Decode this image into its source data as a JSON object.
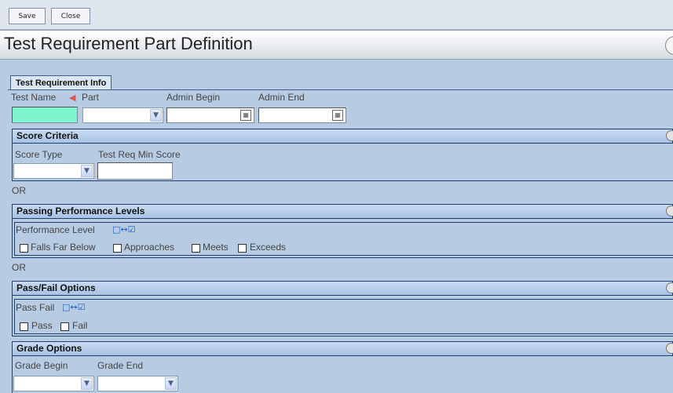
{
  "toolbar": {
    "save_label": "Save",
    "close_label": "Close"
  },
  "page": {
    "title": "Test Requirement Part Definition"
  },
  "tabs": [
    {
      "label": "Test Requirement Info"
    }
  ],
  "info": {
    "labels": {
      "test_name": "Test Name",
      "part": "Part",
      "admin_begin": "Admin Begin",
      "admin_end": "Admin End"
    },
    "values": {
      "test_name": "",
      "part": "",
      "admin_begin": "",
      "admin_end": ""
    }
  },
  "score_criteria": {
    "title": "Score Criteria",
    "labels": {
      "score_type": "Score Type",
      "min_score": "Test Req Min Score"
    },
    "values": {
      "score_type": "",
      "min_score": ""
    }
  },
  "or1": "OR",
  "passing_performance": {
    "title": "Passing Performance Levels",
    "field_label": "Performance Level",
    "options": [
      {
        "label": "Falls Far Below",
        "checked": false
      },
      {
        "label": "Approaches",
        "checked": false
      },
      {
        "label": "Meets",
        "checked": false
      },
      {
        "label": "Exceeds",
        "checked": false
      }
    ]
  },
  "or2": "OR",
  "pass_fail": {
    "title": "Pass/Fail Options",
    "field_label": "Pass Fail",
    "options": [
      {
        "label": "Pass",
        "checked": false
      },
      {
        "label": "Fail",
        "checked": false
      }
    ]
  },
  "grade_options": {
    "title": "Grade Options",
    "labels": {
      "grade_begin": "Grade Begin",
      "grade_end": "Grade End"
    },
    "values": {
      "grade_begin": "",
      "grade_end": ""
    }
  },
  "colors": {
    "test_name_bg": "#7ff5cf",
    "section_border": "#1f3f6e",
    "page_bg": "#b7cce3"
  },
  "icons": {
    "toggle": "select-all-toggle-icon",
    "calendar": "calendar-icon",
    "collapse": "collapse-circle-icon",
    "required": "left-arrow-icon"
  }
}
